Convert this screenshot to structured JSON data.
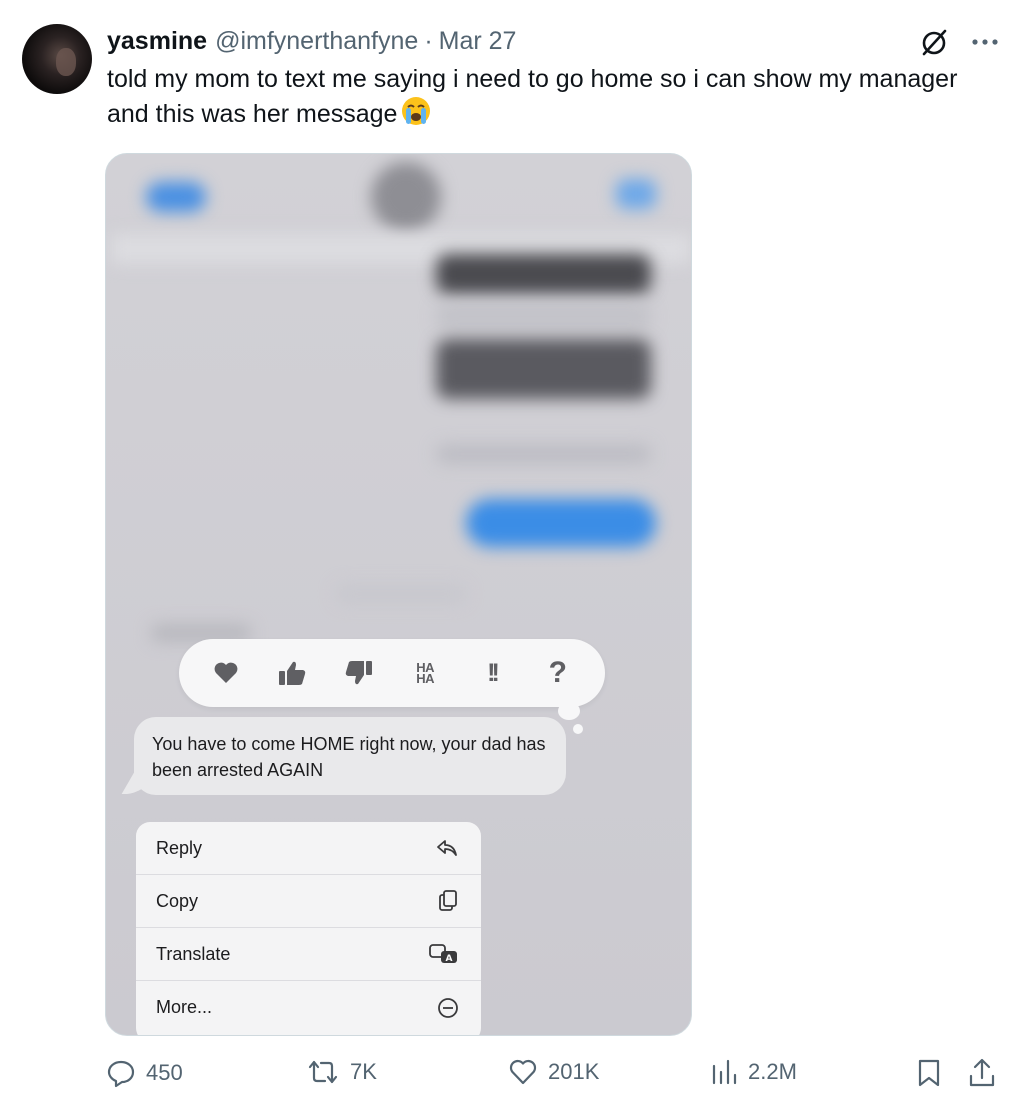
{
  "tweet": {
    "author_name": "yasmine",
    "author_handle": "@imfynerthanfyne",
    "separator": "·",
    "date": "Mar 27",
    "text": "told my mom to text me saying i need to go home so i can show my manager and this was her message",
    "emoji": "loudly-crying-face"
  },
  "media": {
    "reactions": [
      "heart",
      "thumbs-up",
      "thumbs-down",
      "HA HA",
      "!!",
      "?"
    ],
    "message": "You have to come HOME right now, your dad has been arrested AGAIN",
    "menu": [
      {
        "label": "Reply",
        "icon": "reply-icon"
      },
      {
        "label": "Copy",
        "icon": "copy-icon"
      },
      {
        "label": "Translate",
        "icon": "translate-icon"
      },
      {
        "label": "More...",
        "icon": "more-circle-icon"
      }
    ]
  },
  "stats": {
    "replies": "450",
    "reposts": "7K",
    "likes": "201K",
    "views": "2.2M"
  },
  "colors": {
    "text": "#0f1419",
    "secondary": "#536471",
    "border": "#cfd9de",
    "imessage_blue": "#3b8de6"
  }
}
